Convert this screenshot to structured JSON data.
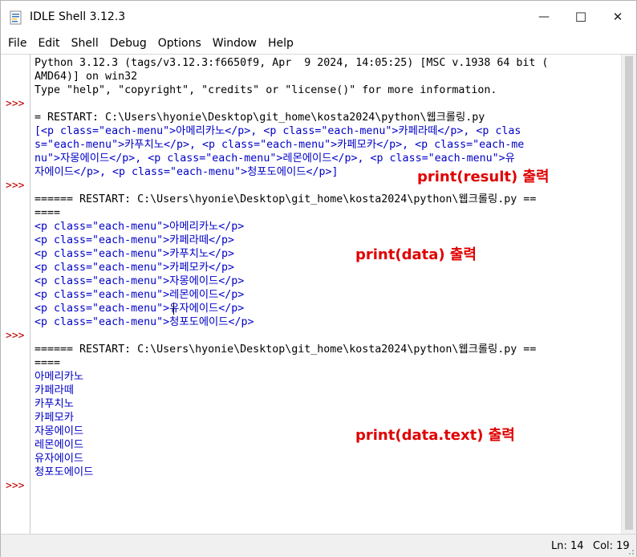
{
  "window": {
    "title": "IDLE Shell 3.12.3"
  },
  "menu": [
    "File",
    "Edit",
    "Shell",
    "Debug",
    "Options",
    "Window",
    "Help"
  ],
  "controls": {
    "minimize_glyph": "—",
    "maximize_glyph": "☐",
    "close_glyph": "✕"
  },
  "prompt_text": ">>>",
  "shell_lines": [
    {
      "text": "Python 3.12.3 (tags/v3.12.3:f6650f9, Apr  9 2024, 14:05:25) [MSC v.1938 64 bit (",
      "style": "std"
    },
    {
      "text": "AMD64)] on win32",
      "style": "std"
    },
    {
      "text": "Type \"help\", \"copyright\", \"credits\" or \"license()\" for more information.",
      "style": "std"
    },
    {
      "text": "",
      "style": "std"
    },
    {
      "text": "= RESTART: C:\\Users\\hyonie\\Desktop\\git_home\\kosta2024\\python\\웹크롤링.py",
      "style": "std"
    },
    {
      "text": "[<p class=\"each-menu\">아메리카노</p>, <p class=\"each-menu\">카페라떼</p>, <p clas",
      "style": "out"
    },
    {
      "text": "s=\"each-menu\">카푸치노</p>, <p class=\"each-menu\">카페모카</p>, <p class=\"each-me",
      "style": "out"
    },
    {
      "text": "nu\">자몽에이드</p>, <p class=\"each-menu\">레몬에이드</p>, <p class=\"each-menu\">유",
      "style": "out"
    },
    {
      "text": "자에이드</p>, <p class=\"each-menu\">청포도에이드</p>]",
      "style": "out"
    },
    {
      "text": "",
      "style": "std"
    },
    {
      "text": "====== RESTART: C:\\Users\\hyonie\\Desktop\\git_home\\kosta2024\\python\\웹크롤링.py ==",
      "style": "std"
    },
    {
      "text": "====",
      "style": "std"
    },
    {
      "text": "<p class=\"each-menu\">아메리카노</p>",
      "style": "out"
    },
    {
      "text": "<p class=\"each-menu\">카페라떼</p>",
      "style": "out"
    },
    {
      "text": "<p class=\"each-menu\">카푸치노</p>",
      "style": "out"
    },
    {
      "text": "<p class=\"each-menu\">카페모카</p>",
      "style": "out"
    },
    {
      "text": "<p class=\"each-menu\">자몽에이드</p>",
      "style": "out"
    },
    {
      "text": "<p class=\"each-menu\">레몬에이드</p>",
      "style": "out"
    },
    {
      "text": "<p class=\"each-menu\">유자에이드</p>",
      "style": "out"
    },
    {
      "text": "<p class=\"each-menu\">청포도에이드</p>",
      "style": "out"
    },
    {
      "text": "",
      "style": "std"
    },
    {
      "text": "====== RESTART: C:\\Users\\hyonie\\Desktop\\git_home\\kosta2024\\python\\웹크롤링.py ==",
      "style": "std"
    },
    {
      "text": "====",
      "style": "std"
    },
    {
      "text": "아메리카노",
      "style": "out"
    },
    {
      "text": "카페라떼",
      "style": "out"
    },
    {
      "text": "카푸치노",
      "style": "out"
    },
    {
      "text": "카페모카",
      "style": "out"
    },
    {
      "text": "자몽에이드",
      "style": "out"
    },
    {
      "text": "레몬에이드",
      "style": "out"
    },
    {
      "text": "유자에이드",
      "style": "out"
    },
    {
      "text": "청포도에이드",
      "style": "out"
    }
  ],
  "annotations": {
    "result": "print(result) 출력",
    "data": "print(data) 출력",
    "data_text": "print(data.text) 출력"
  },
  "status": {
    "line": "Ln: 14",
    "col": "Col: 19"
  },
  "colors": {
    "output_text": "#0000c8",
    "prompt": "#c00000",
    "annotation": "#e00000"
  }
}
